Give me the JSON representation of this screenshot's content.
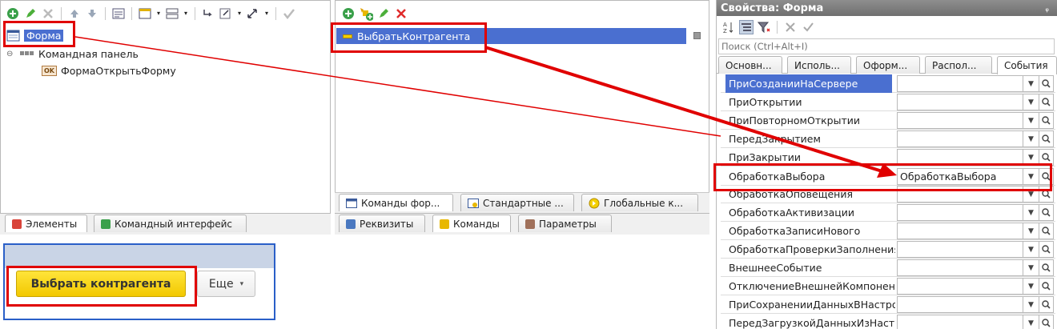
{
  "elements_panel": {
    "tree": [
      {
        "label": "Форма",
        "selected": true
      },
      {
        "label": "Командная панель"
      },
      {
        "label": "ФормаОткрытьФорму",
        "badge": "OK"
      }
    ],
    "tabs": [
      {
        "label": "Элементы",
        "icon_color": "#d9443a"
      },
      {
        "label": "Командный интерфейс",
        "icon_color": "#3aa04a"
      }
    ]
  },
  "commands_panel": {
    "items": [
      {
        "label": "ВыбратьКонтрагента"
      }
    ],
    "inner_tabs": [
      {
        "label": "Команды фор..."
      },
      {
        "label": "Стандартные ..."
      },
      {
        "label": "Глобальные к..."
      }
    ],
    "tabs": [
      {
        "label": "Реквизиты"
      },
      {
        "label": "Команды"
      },
      {
        "label": "Параметры"
      }
    ]
  },
  "preview": {
    "primary_button": "Выбрать контрагента",
    "more_button": "Еще"
  },
  "properties": {
    "title": "Свойства: Форма",
    "pin": "ᵩ",
    "search_placeholder": "Поиск (Ctrl+Alt+I)",
    "tabs": [
      {
        "label": "Основн..."
      },
      {
        "label": "Исполь..."
      },
      {
        "label": "Оформ..."
      },
      {
        "label": "Распол..."
      },
      {
        "label": "События"
      }
    ],
    "events": [
      {
        "name": "ПриСозданииНаСервере",
        "value": "",
        "selected": true
      },
      {
        "name": "ПриОткрытии",
        "value": ""
      },
      {
        "name": "ПриПовторномОткрытии",
        "value": ""
      },
      {
        "name": "ПередЗакрытием",
        "value": ""
      },
      {
        "name": "ПриЗакрытии",
        "value": ""
      },
      {
        "name": "ОбработкаВыбора",
        "value": "ОбработкаВыбора"
      },
      {
        "name": "ОбработкаОповещения",
        "value": ""
      },
      {
        "name": "ОбработкаАктивизации",
        "value": ""
      },
      {
        "name": "ОбработкаЗаписиНового",
        "value": ""
      },
      {
        "name": "ОбработкаПроверкиЗаполнения",
        "value": ""
      },
      {
        "name": "ВнешнееСобытие",
        "value": ""
      },
      {
        "name": "ОтключениеВнешнейКомпоненты",
        "value": ""
      },
      {
        "name": "ПриСохраненииДанныхВНастройках",
        "value": ""
      },
      {
        "name": "ПередЗагрузкойДанныхИзНастроек",
        "value": ""
      }
    ]
  },
  "colors": {
    "selection": "#4a6fd0",
    "highlight": "#e00000",
    "accent_button": "#f5d200"
  }
}
